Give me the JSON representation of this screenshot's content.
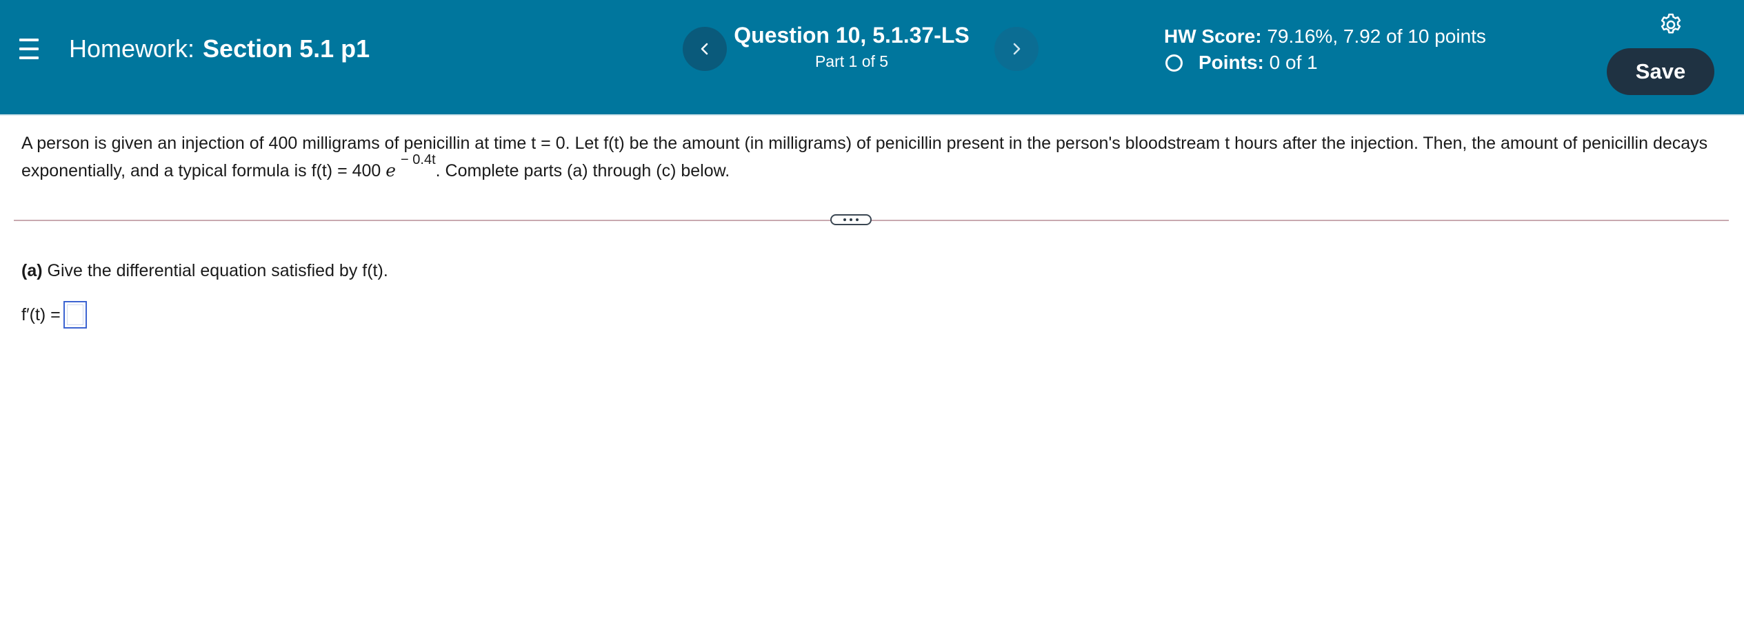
{
  "header": {
    "menu_icon": "hamburger-menu-icon",
    "homework_prefix": "Homework:",
    "homework_name": "Section 5.1 p1",
    "question_title": "Question 10, 5.1.37-LS",
    "question_part": "Part 1 of 5",
    "hw_score_label": "HW Score:",
    "hw_score_value": "79.16%, 7.92 of 10 points",
    "points_label": "Points:",
    "points_value": "0 of 1",
    "save_label": "Save",
    "prev_icon": "chevron-left-icon",
    "next_icon": "chevron-right-icon",
    "settings_icon": "gear-icon",
    "colors": {
      "bar": "#00769d",
      "save_button": "#1f3242",
      "input_border": "#3b63d1"
    }
  },
  "problem": {
    "text_part1": "A person is given an injection of 400 milligrams of penicillin at time t = 0. Let f(t) be the amount (in milligrams) of penicillin present in the person's bloodstream t hours after the injection. Then, the amount of penicillin decays exponentially, and a typical formula is f(t) = 400",
    "e_symbol": "e",
    "exponent": "− 0.4t",
    "text_part2": ". Complete parts (a) through (c) below."
  },
  "part_a": {
    "label": "(a)",
    "prompt": "Give the differential equation satisfied by f(t).",
    "answer_prefix": "f′(t) ="
  }
}
